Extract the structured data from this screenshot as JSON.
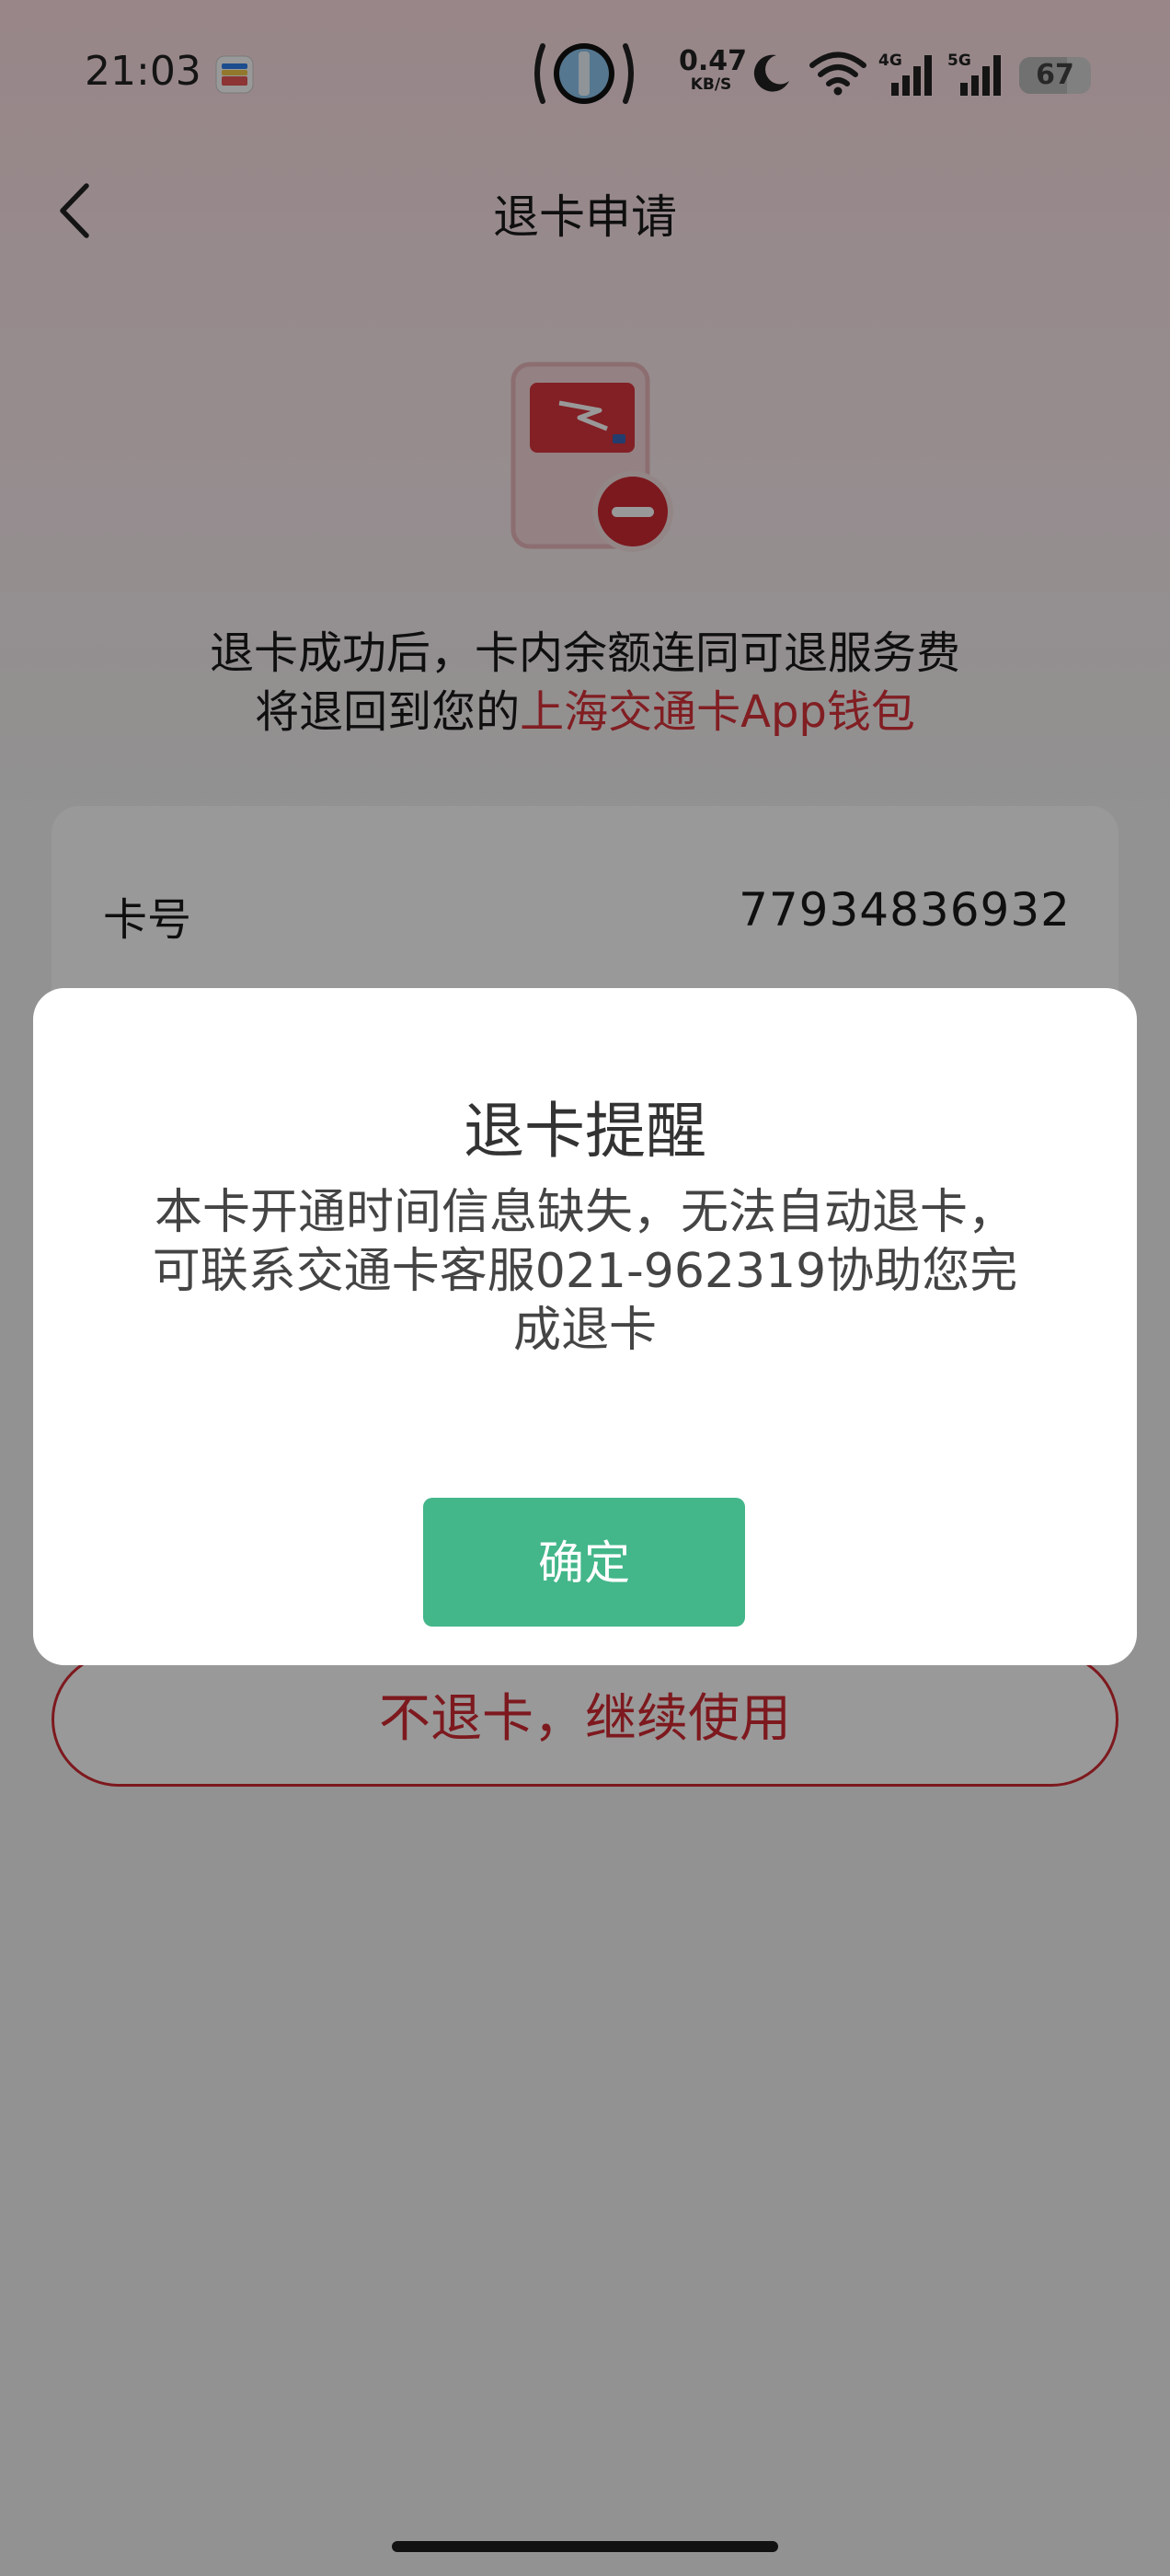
{
  "status_bar": {
    "time": "21:03",
    "net_speed_value": "0.47",
    "net_speed_unit": "KB/S",
    "network_4g": "4G",
    "network_5g": "5G",
    "battery": "67",
    "battery_level": 0.67
  },
  "nav": {
    "title": "退卡申请"
  },
  "hero": {
    "line1": "退卡成功后，卡内余额连同可退服务费",
    "line2_prefix": "将退回到您的",
    "line2_highlight": "上海交通卡App钱包"
  },
  "card": {
    "number_label": "卡号",
    "number_value": "77934836932"
  },
  "continue_button": "不退卡，继续使用",
  "dialog": {
    "title": "退卡提醒",
    "message": "本卡开通时间信息缺失，无法自动退卡，可联系交通卡客服021-962319协助您完成退卡",
    "confirm_label": "确定"
  },
  "colors": {
    "accent_red": "#d02a32",
    "confirm_green": "#43b68a"
  }
}
